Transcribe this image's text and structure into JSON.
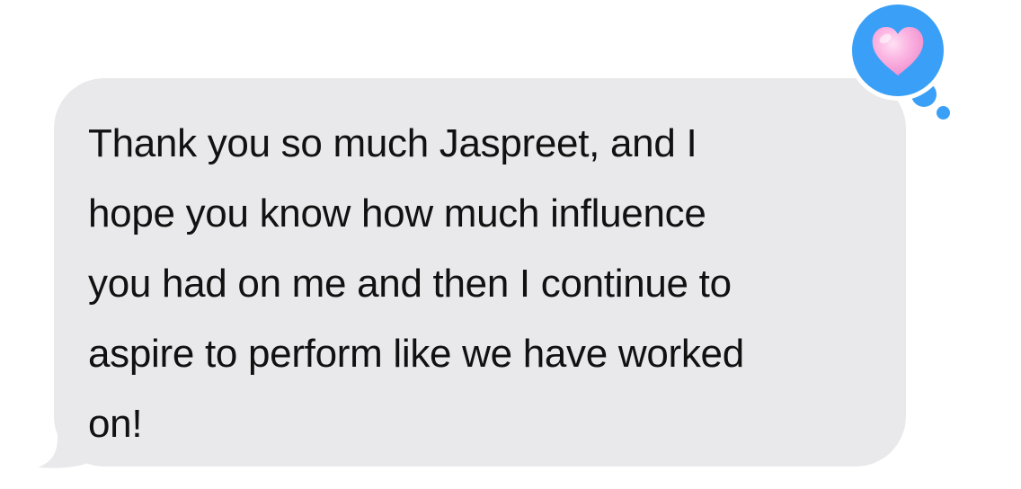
{
  "message": {
    "text": "Thank you so much Jaspreet, and I\nhope you know how much influence\nyou had on me and then I continue to\naspire to perform like we have worked\non!",
    "sender": "received"
  },
  "tapback": {
    "reaction": "heart-icon",
    "bubble_color": "#3aa0f7",
    "heart_color": "#f7a8d8"
  },
  "colors": {
    "received_bubble": "#e9e9eb",
    "text": "#111111",
    "background": "#ffffff"
  }
}
